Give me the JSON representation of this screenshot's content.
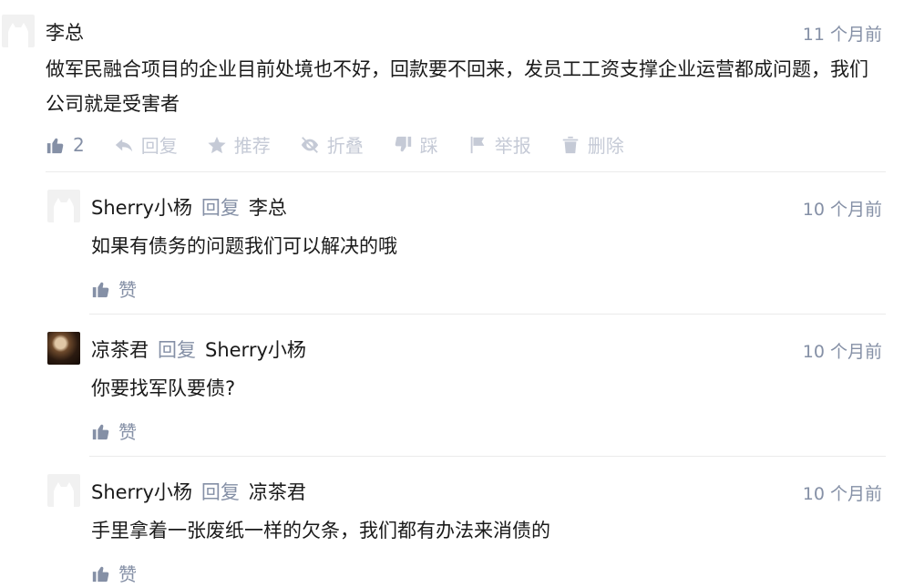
{
  "root_comment": {
    "author": "李总",
    "time": "11 个月前",
    "content": "做军民融合项目的企业目前处境也不好，回款要不回来，发员工工资支撑企业运营都成问题，我们公司就是受害者",
    "like_count": "2",
    "actions": {
      "reply": "回复",
      "recommend": "推荐",
      "collapse": "折叠",
      "dislike": "踩",
      "report": "举报",
      "delete": "删除"
    }
  },
  "replies": [
    {
      "author": "Sherry小杨",
      "reply_word": "回复",
      "reply_to": "李总",
      "time": "10 个月前",
      "content": "如果有债务的问题我们可以解决的哦",
      "like_label": "赞",
      "avatar": "default-cat-avatar"
    },
    {
      "author": "凉茶君",
      "reply_word": "回复",
      "reply_to": "Sherry小杨",
      "time": "10 个月前",
      "content": "你要找军队要债?",
      "like_label": "赞",
      "avatar": "photo-avatar"
    },
    {
      "author": "Sherry小杨",
      "reply_word": "回复",
      "reply_to": "凉茶君",
      "time": "10 个月前",
      "content": "手里拿着一张废纸一样的欠条，我们都有办法来消债的",
      "like_label": "赞",
      "avatar": "default-cat-avatar"
    }
  ],
  "colors": {
    "meta_gray": "#8590a6",
    "action_light_gray": "#c5cad6",
    "text": "#1a1a1a",
    "divider": "#ebebeb"
  }
}
